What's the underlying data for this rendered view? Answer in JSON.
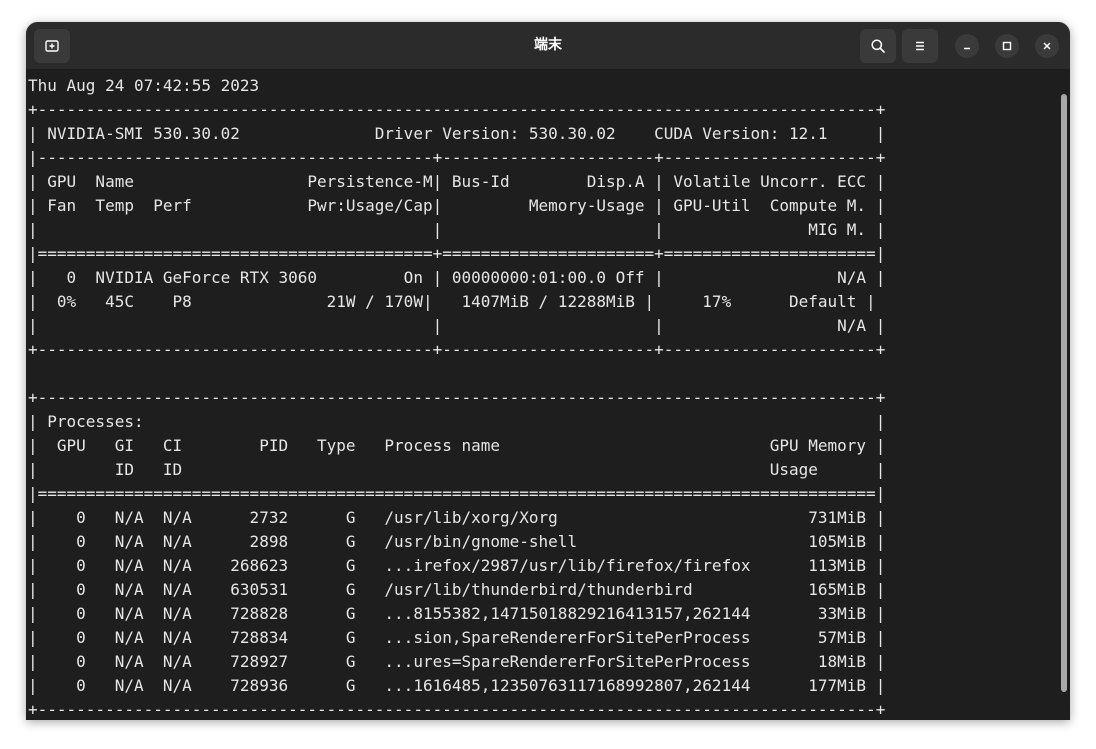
{
  "window": {
    "title": "端末"
  },
  "titlebar": {
    "new_tab_icon": "new-tab-icon",
    "search_icon": "search-icon",
    "menu_icon": "hamburger-menu-icon",
    "minimize_icon": "minimize-icon",
    "maximize_icon": "maximize-icon",
    "close_icon": "close-icon"
  },
  "terminal": {
    "lines": [
      "Thu Aug 24 07:42:55 2023",
      "+---------------------------------------------------------------------------------------+",
      "| NVIDIA-SMI 530.30.02              Driver Version: 530.30.02    CUDA Version: 12.1     |",
      "|-----------------------------------------+----------------------+----------------------+",
      "| GPU  Name                  Persistence-M| Bus-Id        Disp.A | Volatile Uncorr. ECC |",
      "| Fan  Temp  Perf            Pwr:Usage/Cap|         Memory-Usage | GPU-Util  Compute M. |",
      "|                                         |                      |               MIG M. |",
      "|=========================================+======================+======================|",
      "|   0  NVIDIA GeForce RTX 3060         On | 00000000:01:00.0 Off |                  N/A |",
      "|  0%   45C    P8              21W / 170W|   1407MiB / 12288MiB |     17%      Default |",
      "|                                         |                      |                  N/A |",
      "+-----------------------------------------+----------------------+----------------------+",
      "",
      "+---------------------------------------------------------------------------------------+",
      "| Processes:                                                                            |",
      "|  GPU   GI   CI        PID   Type   Process name                            GPU Memory |",
      "|        ID   ID                                                             Usage      |",
      "|=======================================================================================|",
      "|    0   N/A  N/A      2732      G   /usr/lib/xorg/Xorg                          731MiB |",
      "|    0   N/A  N/A      2898      G   /usr/bin/gnome-shell                        105MiB |",
      "|    0   N/A  N/A    268623      G   ...irefox/2987/usr/lib/firefox/firefox      113MiB |",
      "|    0   N/A  N/A    630531      G   /usr/lib/thunderbird/thunderbird            165MiB |",
      "|    0   N/A  N/A    728828      G   ...8155382,14715018829216413157,262144       33MiB |",
      "|    0   N/A  N/A    728834      G   ...sion,SpareRendererForSitePerProcess       57MiB |",
      "|    0   N/A  N/A    728927      G   ...ures=SpareRendererForSitePerProcess       18MiB |",
      "|    0   N/A  N/A    728936      G   ...1616485,12350763117168992807,262144      177MiB |",
      "+---------------------------------------------------------------------------------------+"
    ]
  }
}
